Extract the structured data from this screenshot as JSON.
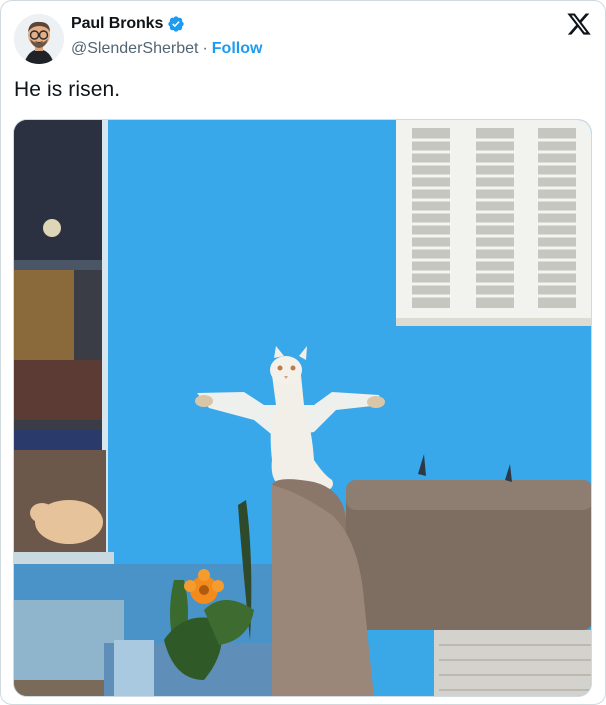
{
  "author": {
    "display_name": "Paul Bronks",
    "handle": "@SlenderSherbet",
    "separator": "·",
    "follow_label": "Follow",
    "verified": true,
    "avatar_icon": "cartoon-avatar-icon"
  },
  "platform": {
    "logo_icon": "x-logo-icon"
  },
  "tweet": {
    "text": "He is risen.",
    "media": {
      "type": "photo"
    }
  },
  "colors": {
    "follow_link": "#1d9bf0",
    "verified_badge": "#1d9bf0",
    "handle_text": "#536471",
    "wall": "#3aa7e6"
  }
}
